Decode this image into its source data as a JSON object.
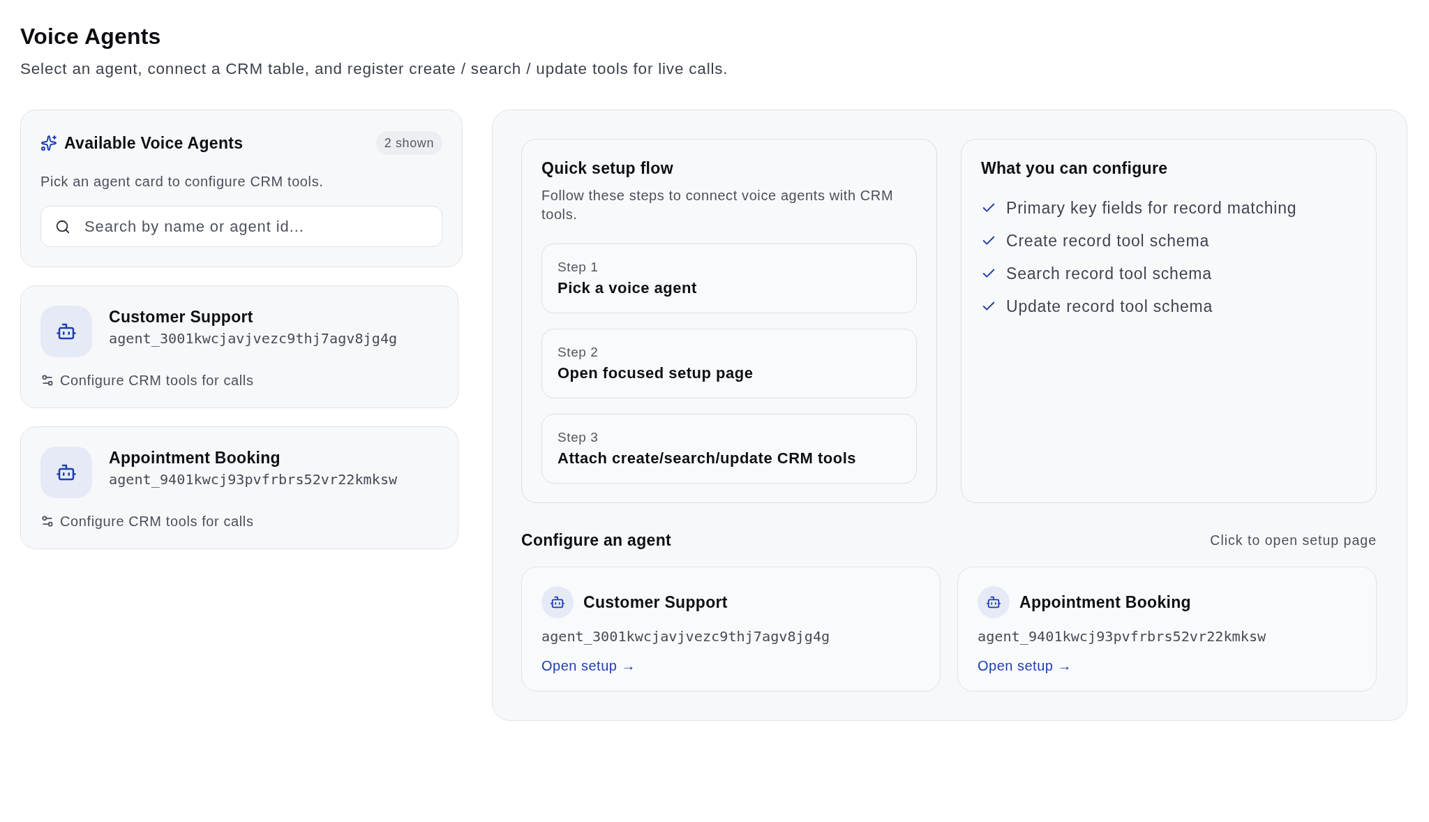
{
  "page": {
    "title": "Voice Agents",
    "subtitle": "Select an agent, connect a CRM table, and register create / search / update tools for live calls."
  },
  "agents_panel": {
    "title": "Available Voice Agents",
    "count_badge": "2 shown",
    "description": "Pick an agent card to configure CRM tools.",
    "search": {
      "placeholder": "Search by name or agent id..."
    }
  },
  "agents": [
    {
      "name": "Customer Support",
      "agent_id": "agent_3001kwcjavjvezc9thj7agv8jg4g",
      "action": "Configure CRM tools for calls"
    },
    {
      "name": "Appointment Booking",
      "agent_id": "agent_9401kwcj93pvfrbrs52vr22kmksw",
      "action": "Configure CRM tools for calls"
    }
  ],
  "quick_setup": {
    "title": "Quick setup flow",
    "description": "Follow these steps to connect voice agents with CRM tools.",
    "steps": [
      {
        "label": "Step 1",
        "title": "Pick a voice agent"
      },
      {
        "label": "Step 2",
        "title": "Open focused setup page"
      },
      {
        "label": "Step 3",
        "title": "Attach create/search/update CRM tools"
      }
    ]
  },
  "capabilities": {
    "title": "What you can configure",
    "items": [
      "Primary key fields for record matching",
      "Create record tool schema",
      "Search record tool schema",
      "Update record tool schema"
    ]
  },
  "configure": {
    "title": "Configure an agent",
    "hint": "Click to open setup page",
    "cards": [
      {
        "name": "Customer Support",
        "agent_id": "agent_3001kwcjavjvezc9thj7agv8jg4g",
        "link": "Open setup →"
      },
      {
        "name": "Appointment Booking",
        "agent_id": "agent_9401kwcj93pvfrbrs52vr22kmksw",
        "link": "Open setup →"
      }
    ]
  }
}
